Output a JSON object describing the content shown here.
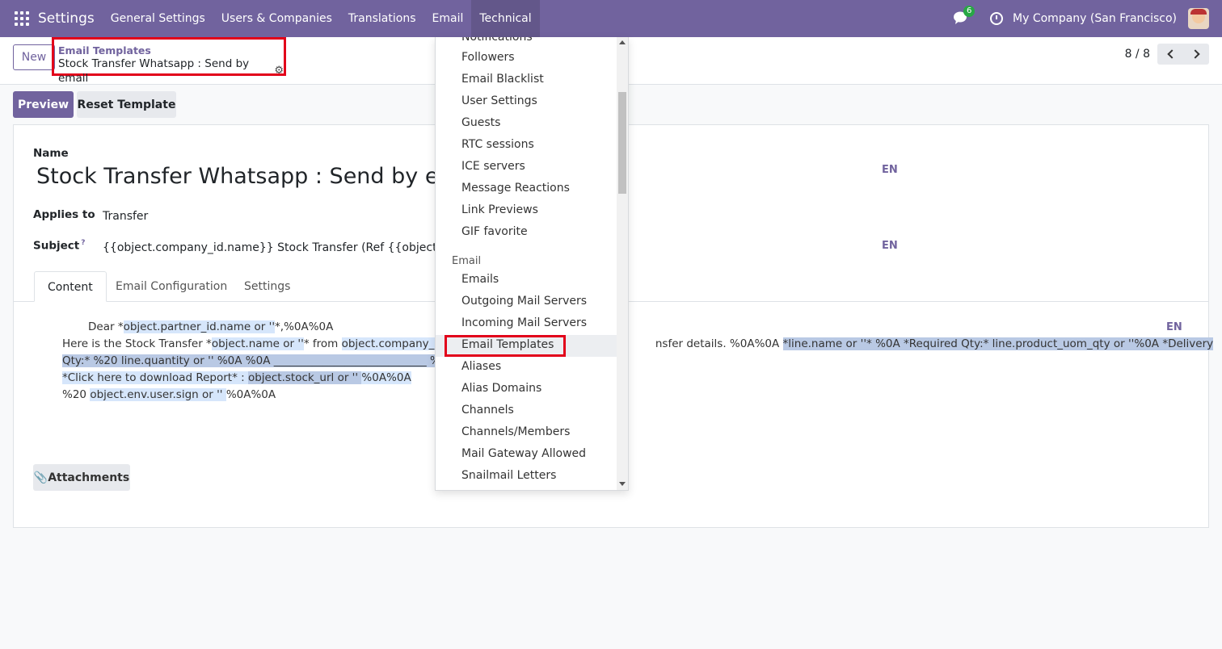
{
  "navbar": {
    "brand": "Settings",
    "menu": [
      "General Settings",
      "Users & Companies",
      "Translations",
      "Email",
      "Technical"
    ],
    "active_menu": "Technical",
    "chat_badge": "6",
    "company": "My Company (San Francisco)"
  },
  "control_panel": {
    "new_label": "New",
    "breadcrumb_parent": "Email Templates",
    "breadcrumb_current": "Stock Transfer Whatsapp : Send by email",
    "pager": "8 / 8"
  },
  "buttons": {
    "preview": "Preview",
    "reset_template": "Reset Template",
    "attachments": "Attachments"
  },
  "form": {
    "name_label": "Name",
    "name_value": "Stock Transfer Whatsapp : Send by ema",
    "lang": "EN",
    "applies_label": "Applies to",
    "applies_value": "Transfer",
    "subject_label": "Subject",
    "subject_help": "?",
    "subject_value": "{{object.company_id.name}} Stock Transfer (Ref {{object.name or"
  },
  "tabs": [
    "Content",
    "Email Configuration",
    "Settings"
  ],
  "body": {
    "line1_a": "Dear *",
    "line1_b": "object.partner_id.name or ''",
    "line1_c": "*,%0A%0A",
    "line2_a": "Here is the Stock Transfer *",
    "line2_b": "object.name or ''",
    "line2_c": "* from ",
    "line2_d": "object.company_id.na",
    "line2_e": "nsfer details. %0A%0A ",
    "line2_f": "*line.name or ''* %0A *Required Qty:* line.product_uom_qty or ''%0A *Delivery",
    "line3": "Qty:* %20 line.quantity or '' %0A %0A ____________________________ %0A%0",
    "line4_a": "*Click here to download Report* : ",
    "line4_b": "object.stock_url or '' ",
    "line4_c": "%0A%0A",
    "line5_a": "%20 ",
    "line5_b": "object.env.user.sign or '' ",
    "line5_c": "%0A%0A"
  },
  "dropdown": {
    "items_top": [
      "Notifications",
      "Followers",
      "Email Blacklist",
      "User Settings",
      "Guests",
      "RTC sessions",
      "ICE servers",
      "Message Reactions",
      "Link Previews",
      "GIF favorite"
    ],
    "section_email": "Email",
    "items_email": [
      "Emails",
      "Outgoing Mail Servers",
      "Incoming Mail Servers",
      "Email Templates",
      "Aliases",
      "Alias Domains",
      "Channels",
      "Channels/Members",
      "Mail Gateway Allowed",
      "Snailmail Letters"
    ]
  }
}
